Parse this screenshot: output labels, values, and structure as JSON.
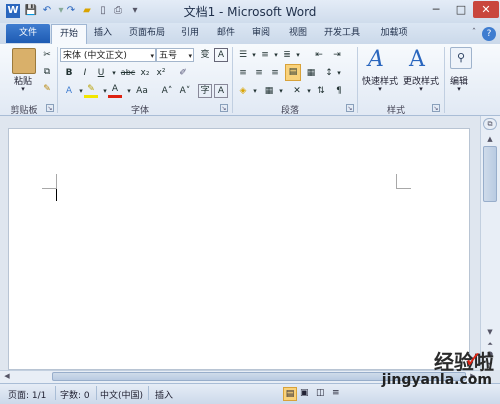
{
  "window": {
    "title": "文档1 - Microsoft Word"
  },
  "titlebar": {
    "qat_icons": [
      "word-app-icon",
      "save-icon",
      "undo-icon",
      "redo-icon",
      "open-icon",
      "new-icon",
      "print-icon",
      "customize-icon"
    ],
    "controls": {
      "minimize": "─",
      "maximize": "□",
      "close": "✕"
    }
  },
  "tabs": {
    "file": "文件",
    "items": [
      "开始",
      "插入",
      "页面布局",
      "引用",
      "邮件",
      "审阅",
      "视图",
      "开发工具",
      "加载项"
    ],
    "help_icon": "?"
  },
  "ribbon": {
    "clipboard": {
      "label": "剪贴板",
      "paste": "粘贴"
    },
    "font": {
      "label": "字体",
      "font_name": "宋体 (中文正文)",
      "font_size": "五号",
      "bold": "B",
      "italic": "I",
      "underline": "U",
      "strike": "abc",
      "subscript": "x₂",
      "superscript": "x²",
      "grow": "A˄",
      "shrink": "A˅",
      "case": "Aa",
      "color_a": "A"
    },
    "paragraph": {
      "label": "段落"
    },
    "styles": {
      "label": "样式",
      "quick_styles": "快速样式",
      "change_styles": "更改样式"
    },
    "editing": {
      "label": "编辑",
      "button": "编辑"
    }
  },
  "statusbar": {
    "page": "页面: 1/1",
    "words": "字数: 0",
    "language": "中文(中国)",
    "mode": "插入"
  },
  "watermark": {
    "line1": "经验啦",
    "line2": "jingyanla.com"
  },
  "colors": {
    "file_tab": "#2a66be",
    "accent": "#1e5bb3"
  }
}
